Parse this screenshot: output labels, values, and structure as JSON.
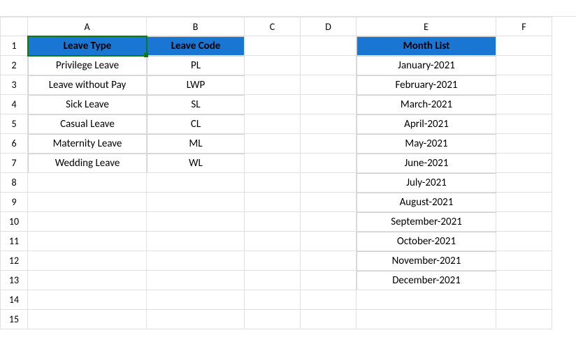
{
  "columns": [
    "A",
    "B",
    "C",
    "D",
    "E",
    "F"
  ],
  "rows": [
    "1",
    "2",
    "3",
    "4",
    "5",
    "6",
    "7",
    "8",
    "9",
    "10",
    "11",
    "12",
    "13",
    "14",
    "15"
  ],
  "active_cell": "A1",
  "headers": {
    "leave_type": "Leave Type",
    "leave_code": "Leave Code",
    "month_list": "Month List"
  },
  "leave_table": [
    {
      "type": "Privilege Leave",
      "code": "PL"
    },
    {
      "type": "Leave without Pay",
      "code": "LWP"
    },
    {
      "type": "Sick Leave",
      "code": "SL"
    },
    {
      "type": "Casual Leave",
      "code": "CL"
    },
    {
      "type": "Maternity Leave",
      "code": "ML"
    },
    {
      "type": "Wedding Leave",
      "code": "WL"
    }
  ],
  "month_list": [
    "January-2021",
    "February-2021",
    "March-2021",
    "April-2021",
    "May-2021",
    "June-2021",
    "July-2021",
    "August-2021",
    "September-2021",
    "October-2021",
    "November-2021",
    "December-2021"
  ]
}
